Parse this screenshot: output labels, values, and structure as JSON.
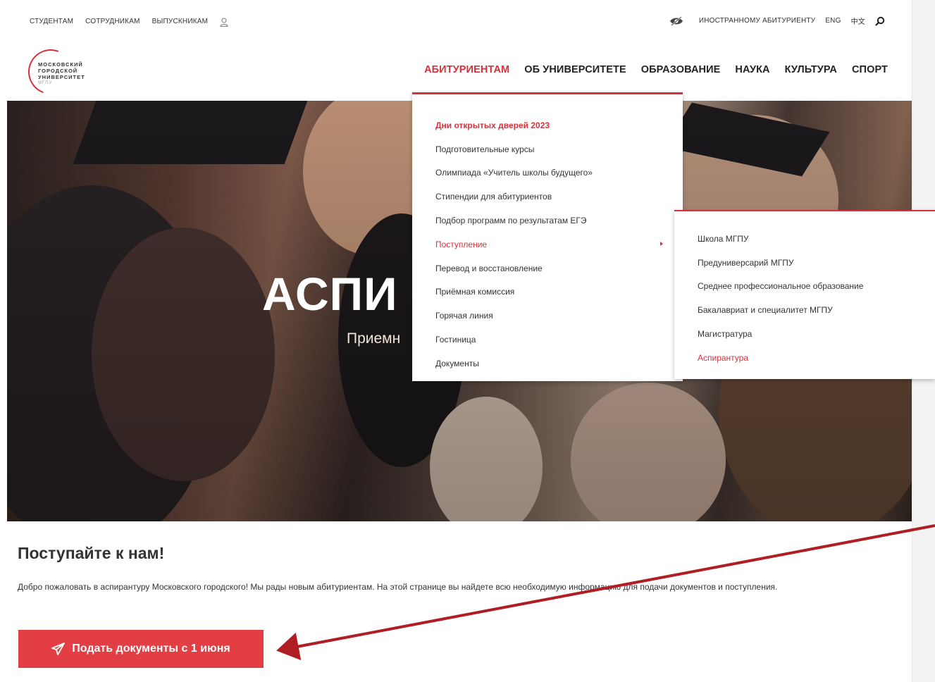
{
  "topbar": {
    "links": [
      "СТУДЕНТАМ",
      "СОТРУДНИКАМ",
      "ВЫПУСКНИКАМ"
    ],
    "foreign_link": "ИНОСТРАННОМУ АБИТУРИЕНТУ",
    "lang_en": "ENG",
    "lang_zh": "中文"
  },
  "logo": {
    "line1": "МОСКОВСКИЙ",
    "line2": "ГОРОДСКОЙ",
    "line3": "УНИВЕРСИТЕТ",
    "line4": "МГПУ"
  },
  "nav": {
    "items": [
      "АБИТУРИЕНТАМ",
      "ОБ УНИВЕРСИТЕТЕ",
      "ОБРАЗОВАНИЕ",
      "НАУКА",
      "КУЛЬТУРА",
      "СПОРТ"
    ],
    "active_index": 0
  },
  "hero": {
    "title": "АСПИ",
    "subtitle": "Приемн"
  },
  "dropdown": {
    "items": [
      "Дни открытых дверей 2023",
      "Подготовительные курсы",
      "Олимпиада «Учитель школы будущего»",
      "Стипендии для абитуриентов",
      "Подбор программ по результатам ЕГЭ",
      "Поступление",
      "Перевод и восстановление",
      "Приёмная комиссия",
      "Горячая линия",
      "Гостиница",
      "Документы"
    ]
  },
  "subdropdown": {
    "items": [
      "Школа МГПУ",
      "Предуниверсарий МГПУ",
      "Среднее профессиональное образование",
      "Бакалавриат и специалитет МГПУ",
      "Магистратура",
      "Аспирантура"
    ]
  },
  "content": {
    "title": "Поступайте к нам!",
    "intro": "Добро пожаловать в аспирантуру Московского городского! Мы рады новым абитуриентам. На этой странице вы найдете всю необходимую информацию для подачи документов и поступления.",
    "cta_label": "Подать документы с 1 июня"
  },
  "colors": {
    "accent": "#d6323a",
    "button": "#e23e44",
    "annotation_arrow": "#b01e24"
  },
  "icons": [
    "user-icon",
    "eye-icon",
    "search-icon",
    "paper-plane-icon"
  ]
}
